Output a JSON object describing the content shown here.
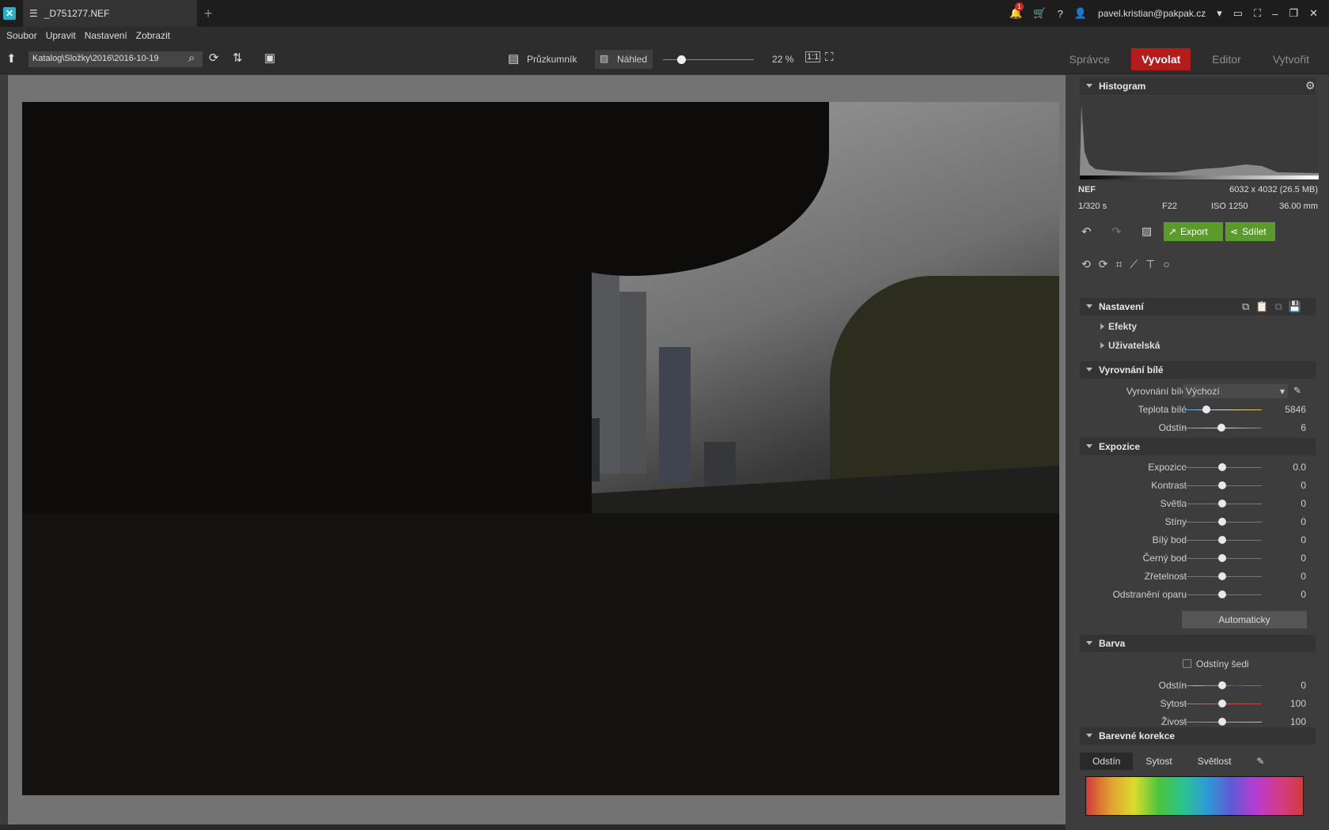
{
  "title": {
    "app_icon": "zoner-icon",
    "tab": "_D751277.NEF",
    "user": "pavel.kristian@pakpak.cz",
    "notif_count": "1"
  },
  "menu": [
    "Soubor",
    "Upravit",
    "Nastavení",
    "Zobrazit"
  ],
  "toolbar": {
    "path": "Katalog\\Složky\\2016\\2016-10-19",
    "browser": "Průzkumník",
    "preview": "Náhled",
    "zoom": "22 %",
    "zoom_fraction": 0.2
  },
  "modes": [
    "Správce",
    "Vyvolat",
    "Editor",
    "Vytvořit"
  ],
  "histogram": {
    "title": "Histogram",
    "format": "NEF",
    "dims": "6032 x 4032 (26.5 MB)",
    "shutter": "1/320 s",
    "aperture": "F22",
    "iso": "ISO 1250",
    "focal": "36.00 mm"
  },
  "actions": {
    "export": "Export",
    "share": "Sdílet"
  },
  "settings": {
    "title": "Nastavení",
    "effects": "Efekty",
    "user": "Uživatelská"
  },
  "wb": {
    "title": "Vyrovnání bílé",
    "label": "Vyrovnání bílé",
    "preset": "Výchozí",
    "temp_label": "Teplota bílé",
    "temp": "5846",
    "tint_label": "Odstín",
    "tint": "6"
  },
  "exposure": {
    "title": "Expozice",
    "auto": "Automaticky",
    "rows": [
      {
        "label": "Expozice",
        "value": "0.0"
      },
      {
        "label": "Kontrast",
        "value": "0"
      },
      {
        "label": "Světla",
        "value": "0"
      },
      {
        "label": "Stíny",
        "value": "0"
      },
      {
        "label": "Bílý bod",
        "value": "0"
      },
      {
        "label": "Černý bod",
        "value": "0"
      },
      {
        "label": "Zřetelnost",
        "value": "0"
      },
      {
        "label": "Odstranění oparu",
        "value": "0"
      }
    ]
  },
  "color": {
    "title": "Barva",
    "gray": "Odstíny šedi",
    "rows": [
      {
        "label": "Odstín",
        "value": "0"
      },
      {
        "label": "Sytost",
        "value": "100"
      },
      {
        "label": "Živost",
        "value": "100"
      }
    ]
  },
  "corrections": {
    "title": "Barevné korekce",
    "tabs": [
      "Odstín",
      "Sytost",
      "Světlost"
    ]
  }
}
